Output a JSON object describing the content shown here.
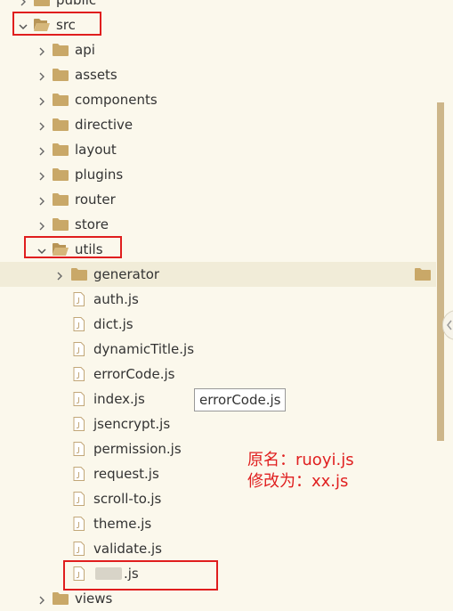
{
  "tree": {
    "public_label": "public",
    "src_label": "src",
    "src_children": [
      "api",
      "assets",
      "components",
      "directive",
      "layout",
      "plugins",
      "router",
      "store"
    ],
    "utils_label": "utils",
    "generator_label": "generator",
    "utils_files": [
      "auth.js",
      "dict.js",
      "dynamicTitle.js",
      "errorCode.js",
      "index.js",
      "jsencrypt.js",
      "permission.js",
      "request.js",
      "scroll-to.js",
      "theme.js",
      "validate.js"
    ],
    "renamed_file_suffix": ".js",
    "views_label": "views"
  },
  "tooltip": {
    "text": "errorCode.js"
  },
  "annotation": {
    "line1": "原名：ruoyi.js",
    "line2": "修改为：xx.js"
  },
  "colors": {
    "folder": "#c9a868",
    "highlight_row": "#f1ecd8",
    "annotation_red": "#e02020"
  }
}
